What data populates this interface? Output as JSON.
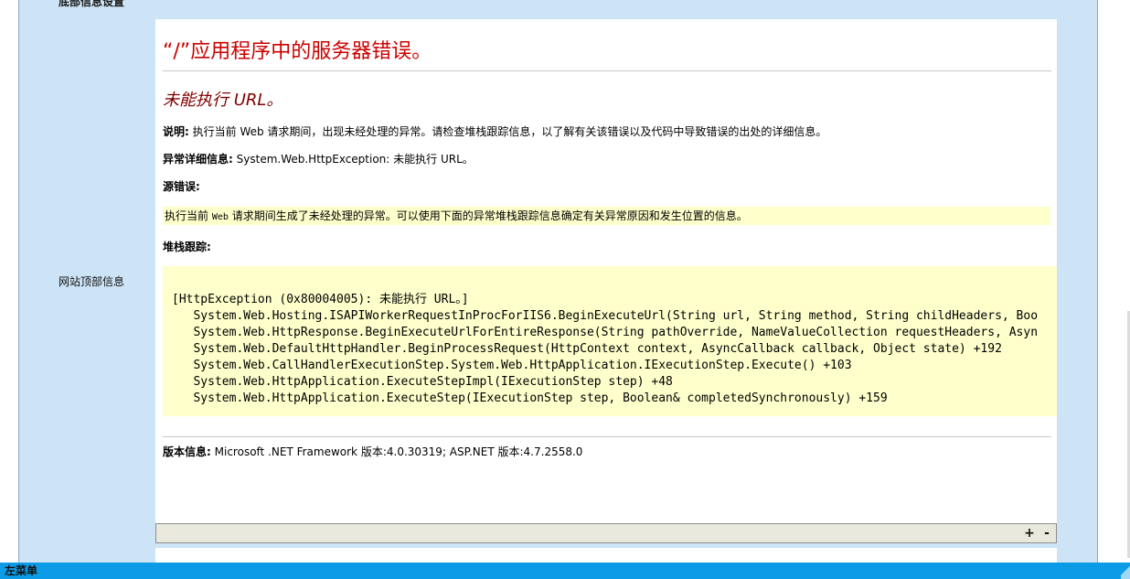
{
  "sidebar": {
    "top_label": "底部信息设置",
    "site_top_label": "网站顶部信息"
  },
  "error_page": {
    "title": "“/”应用程序中的服务器错误。",
    "subtitle": "未能执行 URL。",
    "description_label": "说明:",
    "description_text": "执行当前 Web 请求期间，出现未经处理的异常。请检查堆栈跟踪信息，以了解有关该错误以及代码中导致错误的出处的详细信息。",
    "exception_label": "异常详细信息:",
    "exception_text": "System.Web.HttpException: 未能执行 URL。",
    "source_label": "源错误:",
    "source_text_a": "执行当前 ",
    "source_text_web": "Web",
    "source_text_b": " 请求期间生成了未经处理的异常。可以使用下面的异常堆栈跟踪信息确定有关异常原因和发生位置的信息。",
    "stack_label": "堆栈跟踪:",
    "stack_lines": [
      "[HttpException (0x80004005): 未能执行 URL。]",
      "   System.Web.Hosting.ISAPIWorkerRequestInProcForIIS6.BeginExecuteUrl(String url, String method, String childHeaders, Boo",
      "   System.Web.HttpResponse.BeginExecuteUrlForEntireResponse(String pathOverride, NameValueCollection requestHeaders, Asyn",
      "   System.Web.DefaultHttpHandler.BeginProcessRequest(HttpContext context, AsyncCallback callback, Object state) +192",
      "   System.Web.CallHandlerExecutionStep.System.Web.HttpApplication.IExecutionStep.Execute() +103",
      "   System.Web.HttpApplication.ExecuteStepImpl(IExecutionStep step) +48",
      "   System.Web.HttpApplication.ExecuteStep(IExecutionStep step, Boolean& completedSynchronously) +159"
    ],
    "version_label": "版本信息:",
    "version_text": "Microsoft .NET Framework 版本:4.0.30319; ASP.NET 版本:4.7.2558.0"
  },
  "toolbar": {
    "expand_label": "+",
    "collapse_label": "-"
  },
  "taskbar": {
    "label": "左菜单"
  },
  "colors": {
    "title": "#cc0000",
    "subtitle": "#800000",
    "highlight_box": "#ffffcc",
    "taskbar": "#0c9be6",
    "frame_background": "#cde3f6"
  }
}
